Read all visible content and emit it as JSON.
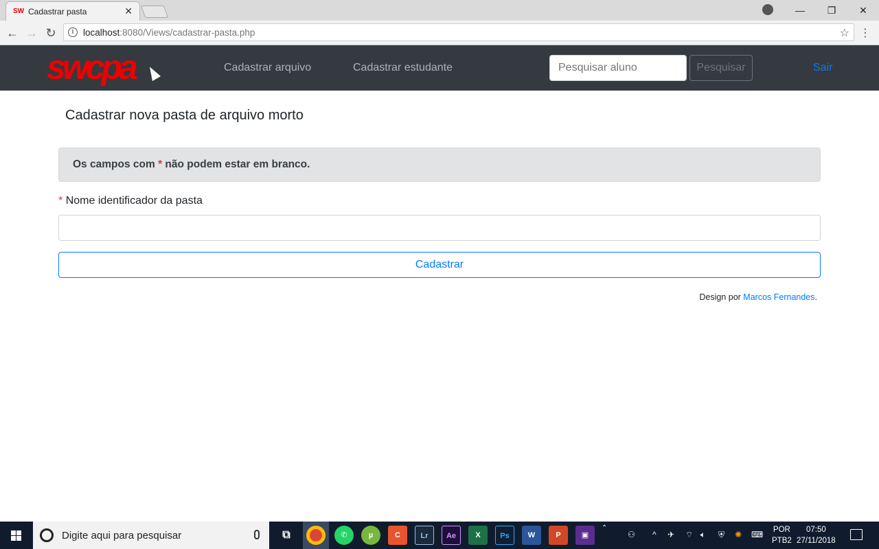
{
  "browser": {
    "tab_title": "Cadastrar pasta",
    "favicon_text": "SW",
    "url_host": "localhost",
    "url_path": ":8080/Views/cadastrar-pasta.php"
  },
  "navbar": {
    "brand": "swcpa",
    "links": [
      "Cadastrar arquivo",
      "Cadastrar estudante"
    ],
    "search_placeholder": "Pesquisar aluno",
    "search_button": "Pesquisar",
    "logout": "Sair"
  },
  "main": {
    "title": "Cadastrar nova pasta de arquivo morto",
    "alert_prefix": "Os campos com",
    "alert_star": "*",
    "alert_suffix": "não podem estar em branco.",
    "field_star": "*",
    "field_label": "Nome identificador da pasta",
    "field_value": "",
    "submit": "Cadastrar"
  },
  "footer": {
    "prefix": "Design por",
    "author": "Marcos Fernandes",
    "suffix": "."
  },
  "taskbar": {
    "search_placeholder": "Digite aqui para pesquisar",
    "language_1": "POR",
    "language_2": "PTB2",
    "time": "07:50",
    "date": "27/11/2018"
  },
  "colors": {
    "navbar_bg": "#343a40",
    "brand": "#ee0000",
    "link": "#007bff",
    "required": "#dc3545"
  }
}
